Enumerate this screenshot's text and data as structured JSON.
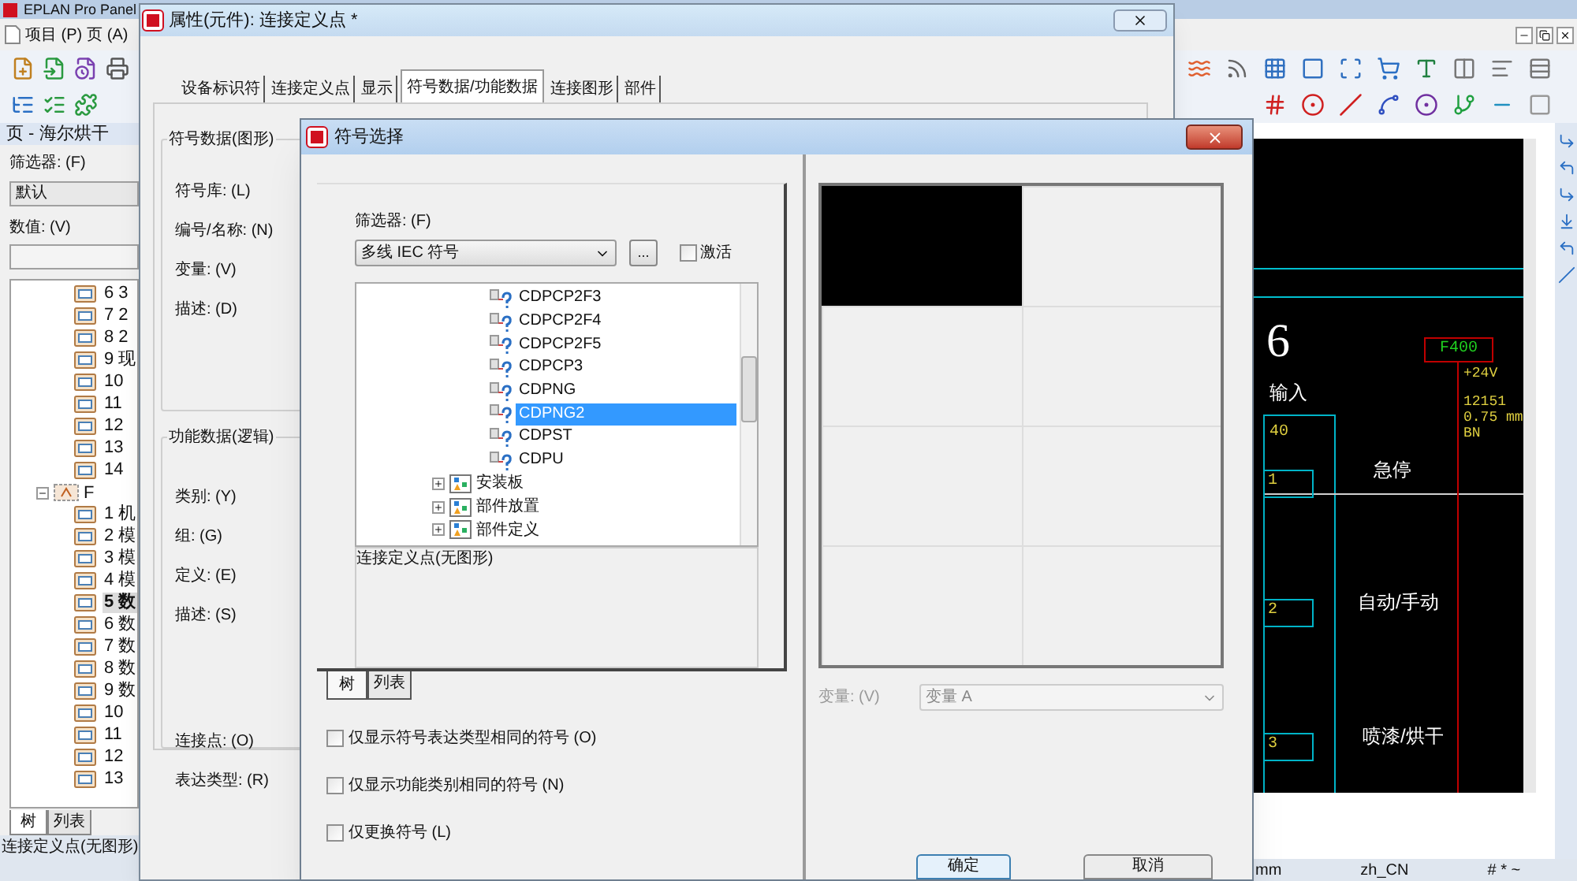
{
  "app": {
    "title": "EPLAN Pro Panel",
    "menu": [
      "项目 (P)",
      "页 (A)"
    ]
  },
  "page_panel": {
    "title": "页 - 海尔烘干",
    "filter_label": "筛选器: (F)",
    "filter_value": "默认",
    "value_label": "数值: (V)",
    "tree": [
      {
        "label": "6 3",
        "selected": false
      },
      {
        "label": "7 2",
        "selected": false
      },
      {
        "label": "8 2",
        "selected": false
      },
      {
        "label": "9 现",
        "selected": false
      },
      {
        "label": "10",
        "selected": false
      },
      {
        "label": "11",
        "selected": false
      },
      {
        "label": "12",
        "selected": false
      },
      {
        "label": "13",
        "selected": false
      },
      {
        "label": "14",
        "selected": false
      },
      {
        "label": "F",
        "expanded": true,
        "selected": false,
        "children": [
          {
            "label": "1 机",
            "selected": false
          },
          {
            "label": "2 模",
            "selected": false
          },
          {
            "label": "3 模",
            "selected": false
          },
          {
            "label": "4 模",
            "selected": false
          },
          {
            "label": "5 数",
            "selected": true
          },
          {
            "label": "6 数",
            "selected": false
          },
          {
            "label": "7 数",
            "selected": false
          },
          {
            "label": "8 数",
            "selected": false
          },
          {
            "label": "9 数",
            "selected": false
          },
          {
            "label": "10",
            "selected": false
          },
          {
            "label": "11",
            "selected": false
          },
          {
            "label": "12",
            "selected": false
          },
          {
            "label": "13",
            "selected": false
          }
        ]
      }
    ],
    "tabs": [
      {
        "label": "树",
        "selected": true
      },
      {
        "label": "列表",
        "selected": false
      }
    ],
    "status": "连接定义点(无图形)"
  },
  "properties_window": {
    "title": "属性(元件): 连接定义点 *",
    "tabs": [
      {
        "label": "设备标识符",
        "selected": false
      },
      {
        "label": "连接定义点",
        "selected": false
      },
      {
        "label": "显示",
        "selected": false
      },
      {
        "label": "符号数据/功能数据",
        "selected": true
      },
      {
        "label": "连接图形",
        "selected": false
      },
      {
        "label": "部件",
        "selected": false
      }
    ],
    "symbol_group": {
      "title": "符号数据(图形)",
      "fields": [
        "符号库: (L)",
        "编号/名称: (N)",
        "变量: (V)",
        "描述: (D)"
      ]
    },
    "function_group": {
      "title": "功能数据(逻辑)",
      "fields": [
        "类别: (Y)",
        "组: (G)",
        "定义: (E)",
        "描述: (S)",
        "连接点: (O)",
        "表达类型: (R)"
      ]
    }
  },
  "symbol_dialog": {
    "title": "符号选择",
    "filter_label": "筛选器: (F)",
    "filter_value": "多线 IEC 符号",
    "more_button": "...",
    "activate": {
      "label": "激活",
      "checked": false
    },
    "tree": [
      {
        "kind": "symbol",
        "label": "CDPCP2F3",
        "selected": false
      },
      {
        "kind": "symbol",
        "label": "CDPCP2F4",
        "selected": false
      },
      {
        "kind": "symbol",
        "label": "CDPCP2F5",
        "selected": false
      },
      {
        "kind": "symbol",
        "label": "CDPCP3",
        "selected": false
      },
      {
        "kind": "symbol",
        "label": "CDPNG",
        "selected": false
      },
      {
        "kind": "symbol",
        "label": "CDPNG2",
        "selected": true
      },
      {
        "kind": "symbol",
        "label": "CDPST",
        "selected": false
      },
      {
        "kind": "symbol",
        "label": "CDPU",
        "selected": false
      },
      {
        "kind": "folder",
        "label": "安装板",
        "expanded": false
      },
      {
        "kind": "folder",
        "label": "部件放置",
        "expanded": false
      },
      {
        "kind": "folder",
        "label": "部件定义",
        "expanded": false
      }
    ],
    "description": "连接定义点(无图形)",
    "tabs": [
      {
        "label": "树",
        "selected": true
      },
      {
        "label": "列表",
        "selected": false
      }
    ],
    "options": [
      {
        "label": "仅显示符号表达类型相同的符号 (O)",
        "checked": false
      },
      {
        "label": "仅显示功能类别相同的符号 (N)",
        "checked": false
      },
      {
        "label": "仅更换符号 (L)",
        "checked": false
      }
    ],
    "variant": {
      "label": "变量: (V)",
      "value": "变量 A",
      "disabled": true
    },
    "buttons": [
      "确定",
      "取消"
    ]
  },
  "schematic": {
    "page_number": "6",
    "heading": "输入",
    "terminal_block": "40",
    "terminals": [
      "1",
      "2",
      "3"
    ],
    "labels": [
      "急停",
      "自动/手动",
      "喷漆/烘干"
    ],
    "potential": "F400",
    "wire": [
      "+24V",
      "12151",
      "0.75 mm",
      "BN"
    ]
  },
  "status_bar": [
    "mm",
    "zh_CN",
    "# * ~"
  ]
}
